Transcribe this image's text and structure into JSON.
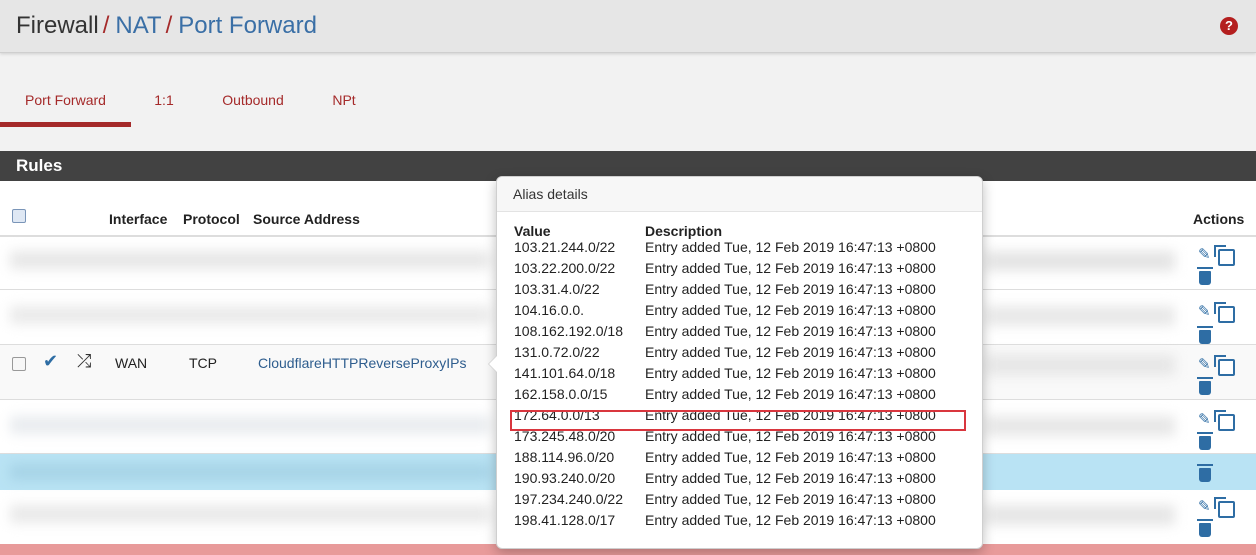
{
  "breadcrumb": {
    "root": "Firewall",
    "sep": "/",
    "nat": "NAT",
    "current": "Port Forward"
  },
  "help_icon": "?",
  "tabs": [
    {
      "label": "Port Forward",
      "active": true
    },
    {
      "label": "1:1"
    },
    {
      "label": "Outbound"
    },
    {
      "label": "NPt"
    }
  ],
  "panel": {
    "title": "Rules",
    "headers": {
      "interface": "Interface",
      "protocol": "Protocol",
      "source_address": "Source Address",
      "actions": "Actions"
    }
  },
  "visible_row": {
    "enabled_icon": "check-icon",
    "nat_icon": "shuffle-icon",
    "interface": "WAN",
    "protocol": "TCP",
    "source_address": "CloudflareHTTPReverseProxyIPs"
  },
  "popover": {
    "title": "Alias details",
    "col_value": "Value",
    "col_description": "Description",
    "entries": [
      {
        "value": "103.21.244.0/22",
        "description": "Entry added Tue, 12 Feb 2019 16:47:13 +0800"
      },
      {
        "value": "103.22.200.0/22",
        "description": "Entry added Tue, 12 Feb 2019 16:47:13 +0800"
      },
      {
        "value": "103.31.4.0/22",
        "description": "Entry added Tue, 12 Feb 2019 16:47:13 +0800"
      },
      {
        "value": "104.16.0.0.",
        "description": "Entry added Tue, 12 Feb 2019 16:47:13 +0800"
      },
      {
        "value": "108.162.192.0/18",
        "description": "Entry added Tue, 12 Feb 2019 16:47:13 +0800"
      },
      {
        "value": "131.0.72.0/22",
        "description": "Entry added Tue, 12 Feb 2019 16:47:13 +0800"
      },
      {
        "value": "141.101.64.0/18",
        "description": "Entry added Tue, 12 Feb 2019 16:47:13 +0800"
      },
      {
        "value": "162.158.0.0/15",
        "description": "Entry added Tue, 12 Feb 2019 16:47:13 +0800"
      },
      {
        "value": "172.64.0.0/13",
        "description": "Entry added Tue, 12 Feb 2019 16:47:13 +0800",
        "highlighted": true
      },
      {
        "value": "173.245.48.0/20",
        "description": "Entry added Tue, 12 Feb 2019 16:47:13 +0800"
      },
      {
        "value": "188.114.96.0/20",
        "description": "Entry added Tue, 12 Feb 2019 16:47:13 +0800"
      },
      {
        "value": "190.93.240.0/20",
        "description": "Entry added Tue, 12 Feb 2019 16:47:13 +0800"
      },
      {
        "value": "197.234.240.0/22",
        "description": "Entry added Tue, 12 Feb 2019 16:47:13 +0800"
      },
      {
        "value": "198.41.128.0/17",
        "description": "Entry added Tue, 12 Feb 2019 16:47:13 +0800"
      }
    ]
  },
  "colors": {
    "accent": "#a52a2a",
    "link": "#3a6fa6",
    "panel_header": "#424242",
    "highlight_border": "#d9363e",
    "selected_row": "#b9e3f4"
  }
}
